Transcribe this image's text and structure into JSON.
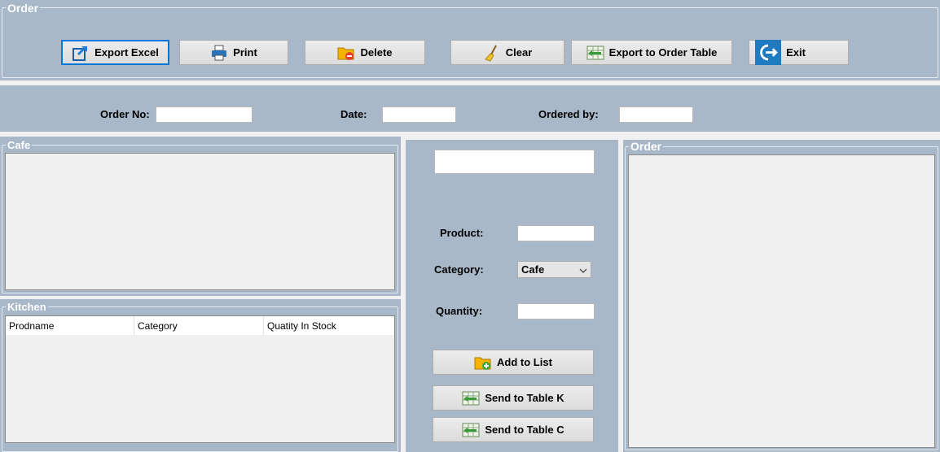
{
  "toolbar": {
    "group_title": "Order",
    "buttons": {
      "export_excel": "Export Excel",
      "print": "Print",
      "delete": "Delete",
      "clear": "Clear",
      "export_order_table": "Export to Order Table",
      "exit": "Exit"
    }
  },
  "header_form": {
    "order_no_label": "Order No:",
    "order_no_value": "",
    "date_label": "Date:",
    "date_value": "",
    "ordered_by_label": "Ordered by:",
    "ordered_by_value": ""
  },
  "cafe_group": {
    "title": "Cafe"
  },
  "kitchen_group": {
    "title": "Kitchen",
    "columns": [
      "Prodname",
      "Category",
      "Quatity In Stock"
    ]
  },
  "entry_form": {
    "top_field_value": "",
    "product_label": "Product:",
    "product_value": "",
    "category_label": "Category:",
    "category_value": "Cafe",
    "quantity_label": "Quantity:",
    "quantity_value": "",
    "add_to_list": "Add to List",
    "send_table_k": "Send to Table K",
    "send_table_c": "Send to Table C"
  },
  "order_group": {
    "title": "Order"
  },
  "colors": {
    "panel": "#a8b8c8",
    "background": "#f1f1f1",
    "focus": "#0078d7"
  }
}
